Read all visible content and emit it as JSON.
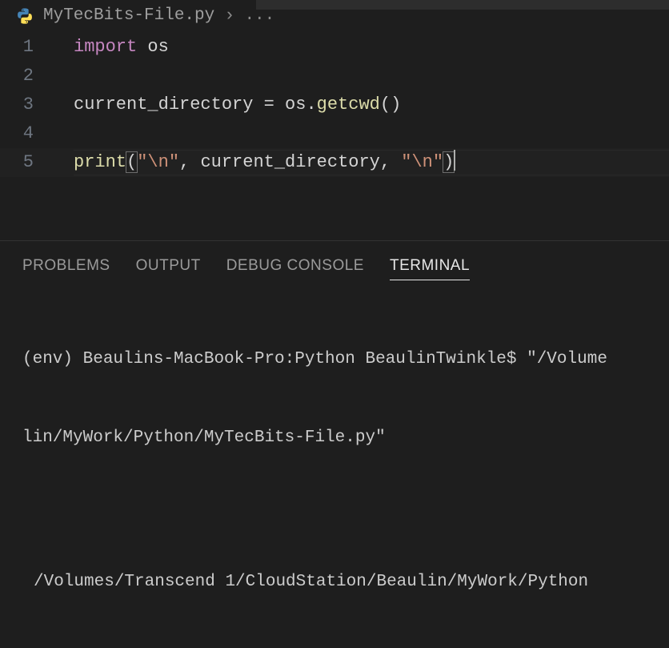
{
  "breadcrumb": {
    "filename": "MyTecBits-File.py",
    "rest": "..."
  },
  "lines": {
    "n1": "1",
    "n2": "2",
    "n3": "3",
    "n4": "4",
    "n5": "5"
  },
  "code": {
    "l1_import": "import",
    "l1_os": " os",
    "l3_var": "current_directory ",
    "l3_eq": "=",
    "l3_os": " os",
    "l3_dot": ".",
    "l3_func": "getcwd",
    "l3_p1": "(",
    "l3_p2": ")",
    "l5_print": "print",
    "l5_po": "(",
    "l5_s1": "\"\\n\"",
    "l5_c1": ", ",
    "l5_var": "current_directory",
    "l5_c2": ", ",
    "l5_s2": "\"\\n\"",
    "l5_pc": ")"
  },
  "panel": {
    "tabs": {
      "problems": "PROBLEMS",
      "output": "OUTPUT",
      "debug": "DEBUG CONSOLE",
      "terminal": "TERMINAL"
    }
  },
  "terminal": {
    "line1": "(env) Beaulins-MacBook-Pro:Python BeaulinTwinkle$ \"/Volume",
    "line1b": "lin/MyWork/Python/MyTecBits-File.py\"",
    "line2": "/Volumes/Transcend 1/CloudStation/Beaulin/MyWork/Python"
  }
}
